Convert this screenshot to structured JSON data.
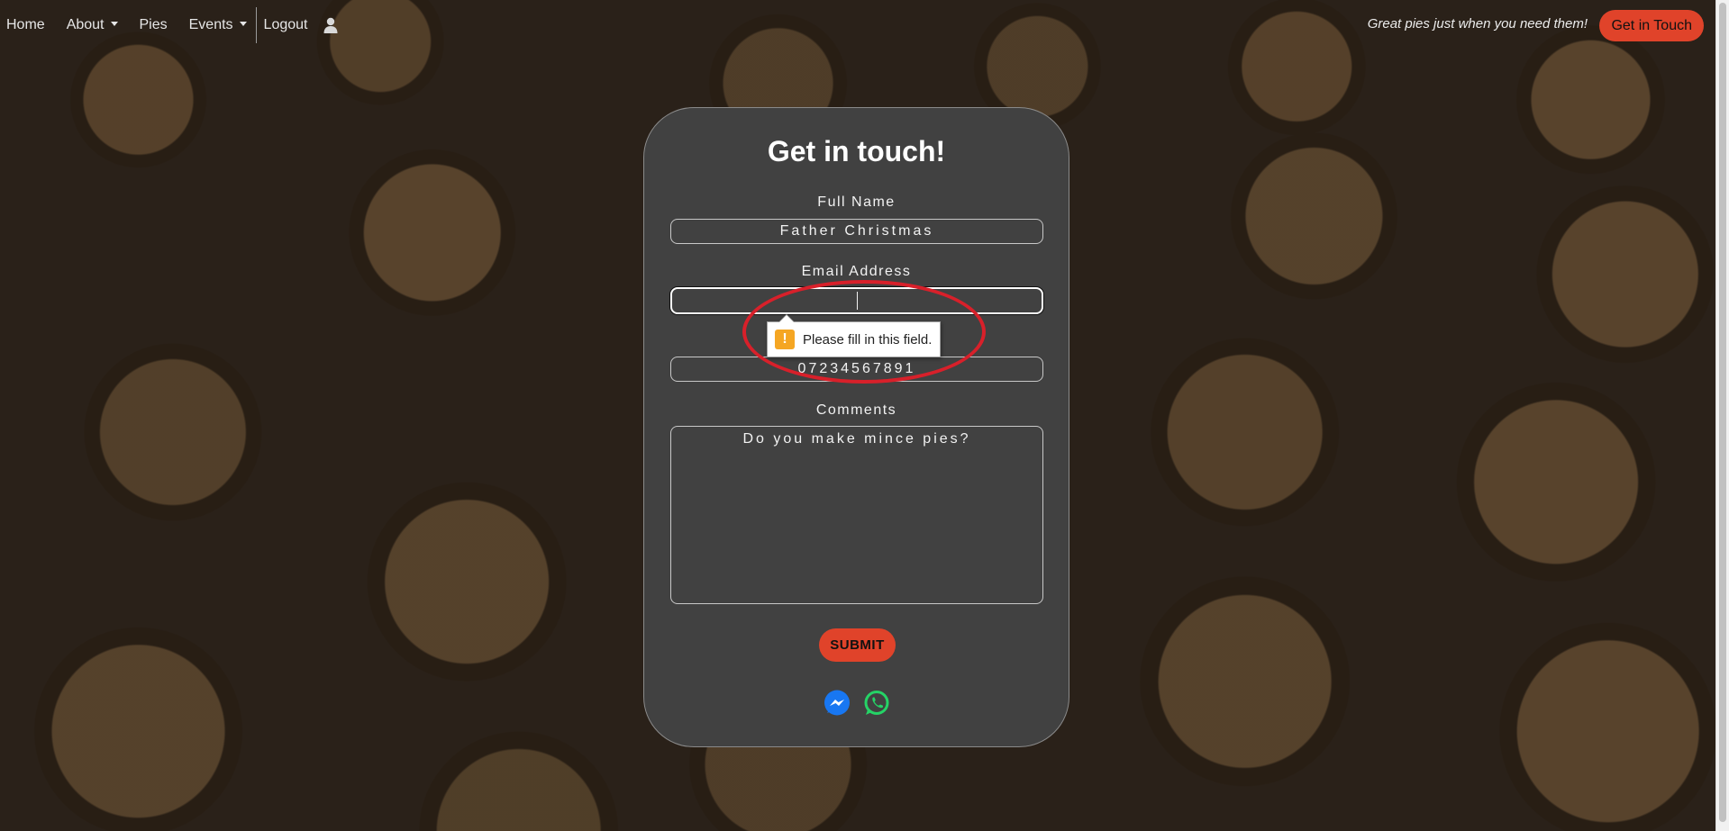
{
  "nav": {
    "items": [
      {
        "label": "Home",
        "dropdown": false
      },
      {
        "label": "About",
        "dropdown": true
      },
      {
        "label": "Pies",
        "dropdown": false
      },
      {
        "label": "Events",
        "dropdown": true
      }
    ],
    "logout_label": "Logout",
    "tagline": "Great pies just when you need them!",
    "cta_label": "Get in Touch"
  },
  "form": {
    "title": "Get in touch!",
    "full_name_label": "Full Name",
    "full_name_value": "Father Christmas",
    "email_label": "Email Address",
    "email_value": "",
    "phone_value": "07234567891",
    "comments_label": "Comments",
    "comments_value": "Do you make mince pies?",
    "submit_label": "SUBMIT"
  },
  "validation": {
    "message": "Please fill in this field.",
    "icon": "!"
  },
  "colors": {
    "accent": "#e0432a",
    "card_bg": "#414141",
    "messenger": "#1877f2",
    "whatsapp": "#25d366",
    "annotation": "#d8202a"
  },
  "icons": {
    "user": "user-icon",
    "messenger": "messenger-icon",
    "whatsapp": "whatsapp-icon",
    "warning": "warning-icon"
  }
}
